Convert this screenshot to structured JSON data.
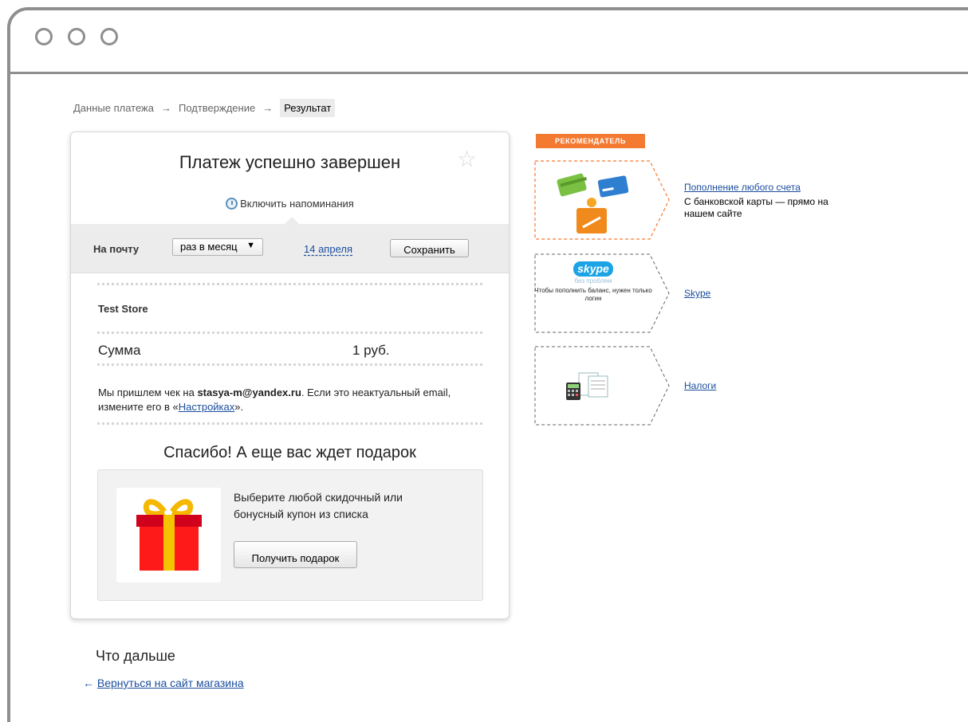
{
  "breadcrumb": {
    "steps": [
      "Данные платежа",
      "Подтверждение",
      "Результат"
    ],
    "arrow": "→"
  },
  "card": {
    "title": "Платеж успешно завершен",
    "reminders_link": "Включить напоминания",
    "reminder_bar": {
      "label": "На почту",
      "frequency": "раз в месяц",
      "date": "14 апреля",
      "save": "Сохранить"
    },
    "store": "Test Store",
    "sum_label": "Сумма",
    "sum_value": "1 руб.",
    "receipt": {
      "prefix": "Мы пришлем чек на ",
      "email": "stasya-m@yandex.ru",
      "middle": ". Если это неактуальный email, измените его в «",
      "settings_link": "Настройках",
      "suffix": "»."
    },
    "thanks": "Спасибо! А еще вас ждет подарок",
    "gift_text": "Выберите любой скидочный или бонусный купон из списка",
    "gift_button": "Получить подарок"
  },
  "next": {
    "title": "Что дальше",
    "back_arrow": "←",
    "back_link": "Вернуться на сайт магазина"
  },
  "recommender": {
    "badge": "РЕКОМЕНДАТЕЛЬ",
    "items": [
      {
        "link": "Пополнение любого счета",
        "desc": "С банковской карты — прямо на нашем сайте",
        "icon": "wallet-cards-icon",
        "border_color": "#f47a31"
      },
      {
        "link": "Skype",
        "icon": "skype-icon",
        "logo": "skype",
        "sub": "без проблем",
        "text": "Чтобы пополнить баланс, нужен только логин",
        "border_color": "#666666"
      },
      {
        "link": "Налоги",
        "icon": "calculator-icon",
        "border_color": "#666666"
      }
    ]
  },
  "colors": {
    "accent_orange": "#f47a31",
    "link_blue": "#1a4d9e",
    "frame_gray": "#8f8f8f"
  }
}
